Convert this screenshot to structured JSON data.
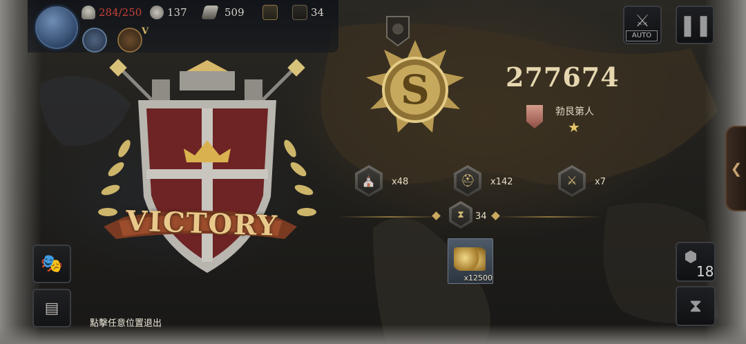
{
  "topbar": {
    "soldiers": "284/250",
    "coins": "137",
    "iron": "509",
    "turns": "34",
    "rank_letter": "V"
  },
  "buttons": {
    "auto_label": "AUTO"
  },
  "result": {
    "banner_text": "VICTORY",
    "score": "277674",
    "rank_title": "勃艮第人",
    "rank_stars": 1
  },
  "stats": [
    {
      "icon": "city-icon",
      "value": "x48"
    },
    {
      "icon": "helmet-icon",
      "value": "x142"
    },
    {
      "icon": "broken-weapon-icon",
      "value": "x7"
    }
  ],
  "turns": {
    "value": "34"
  },
  "reward": {
    "item": "gold-coins-icon",
    "qty": "x12500"
  },
  "hint": "點擊任意位置退出",
  "right_counter": "18",
  "colors": {
    "soldiers_over": "#c8413a",
    "accent_gold": "#e0c27a"
  }
}
